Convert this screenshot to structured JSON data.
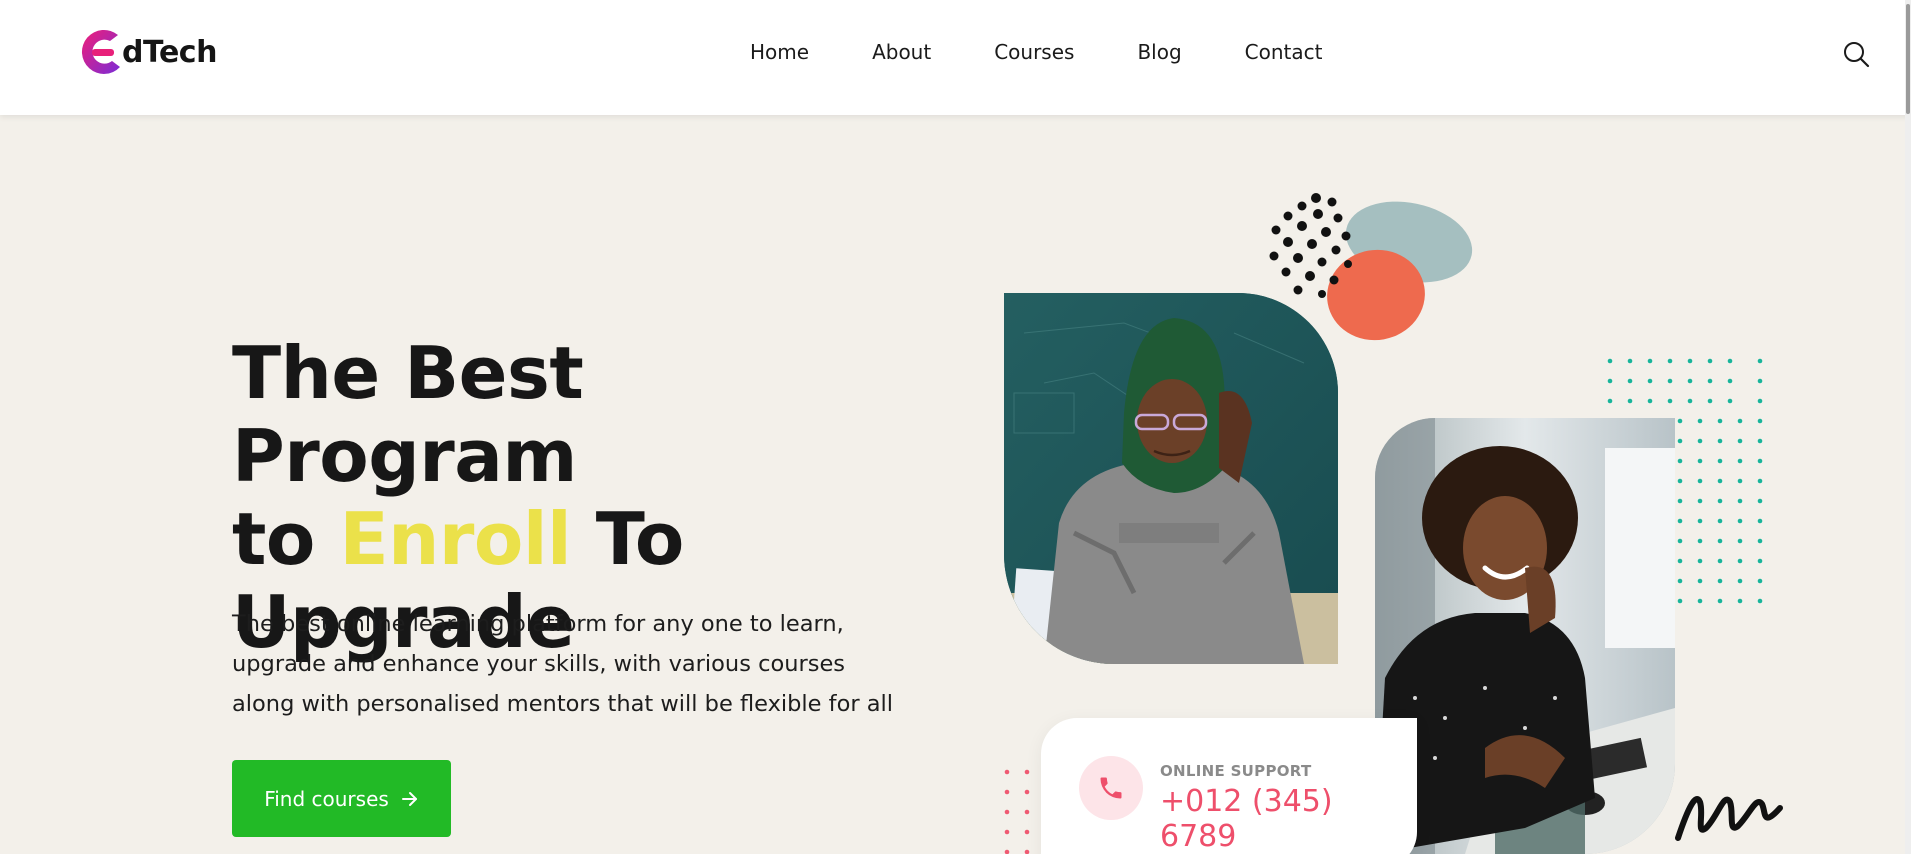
{
  "brand": {
    "logo_letter": "e",
    "name": "dTech",
    "gradient_start": "#f01e78",
    "gradient_end": "#7b2cd6"
  },
  "nav": {
    "items": [
      {
        "label": "Home"
      },
      {
        "label": "About"
      },
      {
        "label": "Courses"
      },
      {
        "label": "Blog"
      },
      {
        "label": "Contact"
      }
    ]
  },
  "header": {
    "search_icon": "search-icon"
  },
  "hero": {
    "title_line1": "The Best Program",
    "title_line2_start": "to ",
    "title_highlight": "Enroll",
    "title_line2_end": " To",
    "title_line3": "Upgrade",
    "description": "The best online learning platform for any one to learn, upgrade and enhance your skills, with various courses along with personalised mentors that will be flexible for all",
    "cta_label": "Find courses",
    "cta_icon": "arrow-right-icon"
  },
  "support": {
    "label": "ONLINE SUPPORT",
    "phone": "+012 (345) 6789",
    "icon": "phone-icon"
  },
  "colors": {
    "accent_yellow": "#ebe14a",
    "cta_green": "#22ba26",
    "support_pink": "#ee4f6b",
    "background": "#f3f0ea"
  }
}
